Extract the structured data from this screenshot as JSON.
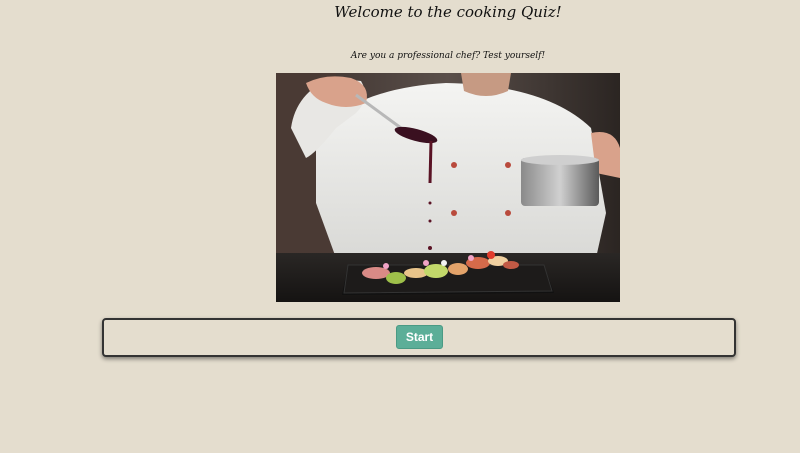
{
  "page": {
    "title": "Welcome to the cooking Quiz!",
    "subtitle": "Are you a professional chef? Test yourself!"
  },
  "hero_image": {
    "description_icon": "chef-plating-photo"
  },
  "quiz": {
    "start_label": "Start"
  },
  "colors": {
    "background": "#e4ddce",
    "start_button": "#5cae98",
    "panel_border": "#333333"
  }
}
